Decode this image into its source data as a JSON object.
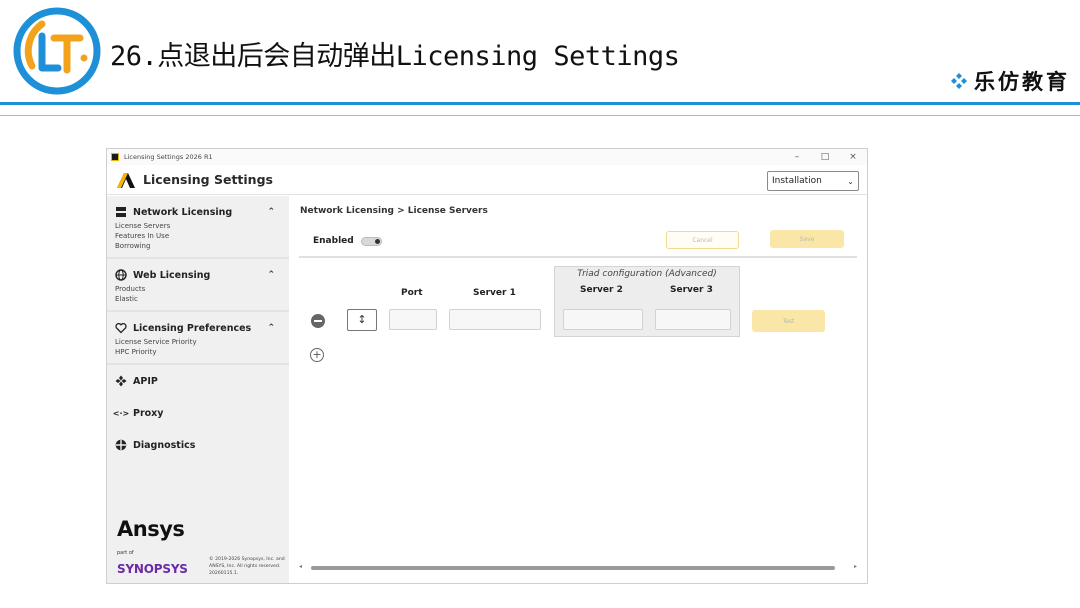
{
  "slide": {
    "title": "26.点退出后会自动弹出Licensing Settings",
    "brand": "乐仿教育",
    "logo_text": "LT"
  },
  "window": {
    "titlebar_text": "Licensing Settings 2026 R1",
    "controls": {
      "minimize": "–",
      "maximize": "□",
      "close": "×"
    },
    "app_title": "Licensing Settings",
    "install_select": "Installation"
  },
  "sidebar": {
    "sections": [
      {
        "label": "Network Licensing",
        "icon": "server-icon",
        "subitems": [
          "License Servers",
          "Features In Use",
          "Borrowing"
        ]
      },
      {
        "label": "Web Licensing",
        "icon": "globe-icon",
        "subitems": [
          "Products",
          "Elastic"
        ]
      },
      {
        "label": "Licensing Preferences",
        "icon": "heart-icon",
        "subitems": [
          "License Service Priority",
          "HPC Priority"
        ]
      }
    ],
    "plain_items": [
      {
        "label": "APIP",
        "icon": "apip-icon"
      },
      {
        "label": "Proxy",
        "icon": "proxy-icon"
      },
      {
        "label": "Diagnostics",
        "icon": "diagnostics-icon"
      }
    ],
    "footer": {
      "ansys": "Ansys",
      "part_of": "part of",
      "synopsys": "SYNOPSYS",
      "copyright": "© 2019-2026 Synopsys, Inc. and ANSYS, Inc. All rights reserved. 20260115.1."
    }
  },
  "main": {
    "breadcrumb": "Network Licensing > License Servers",
    "enabled_label": "Enabled",
    "cancel_label": "Cancel",
    "save_label": "Save",
    "triad_title": "Triad configuration (Advanced)",
    "columns": {
      "port": "Port",
      "server1": "Server 1",
      "server2": "Server 2",
      "server3": "Server 3"
    },
    "test_label": "Test",
    "sort_glyph": "↕",
    "plus_glyph": "+"
  },
  "colors": {
    "accent_blue": "#1e90d8",
    "accent_gold": "#d9b44a",
    "button_yellow": "#fae7a8",
    "synopsys_purple": "#6b2aa6"
  }
}
